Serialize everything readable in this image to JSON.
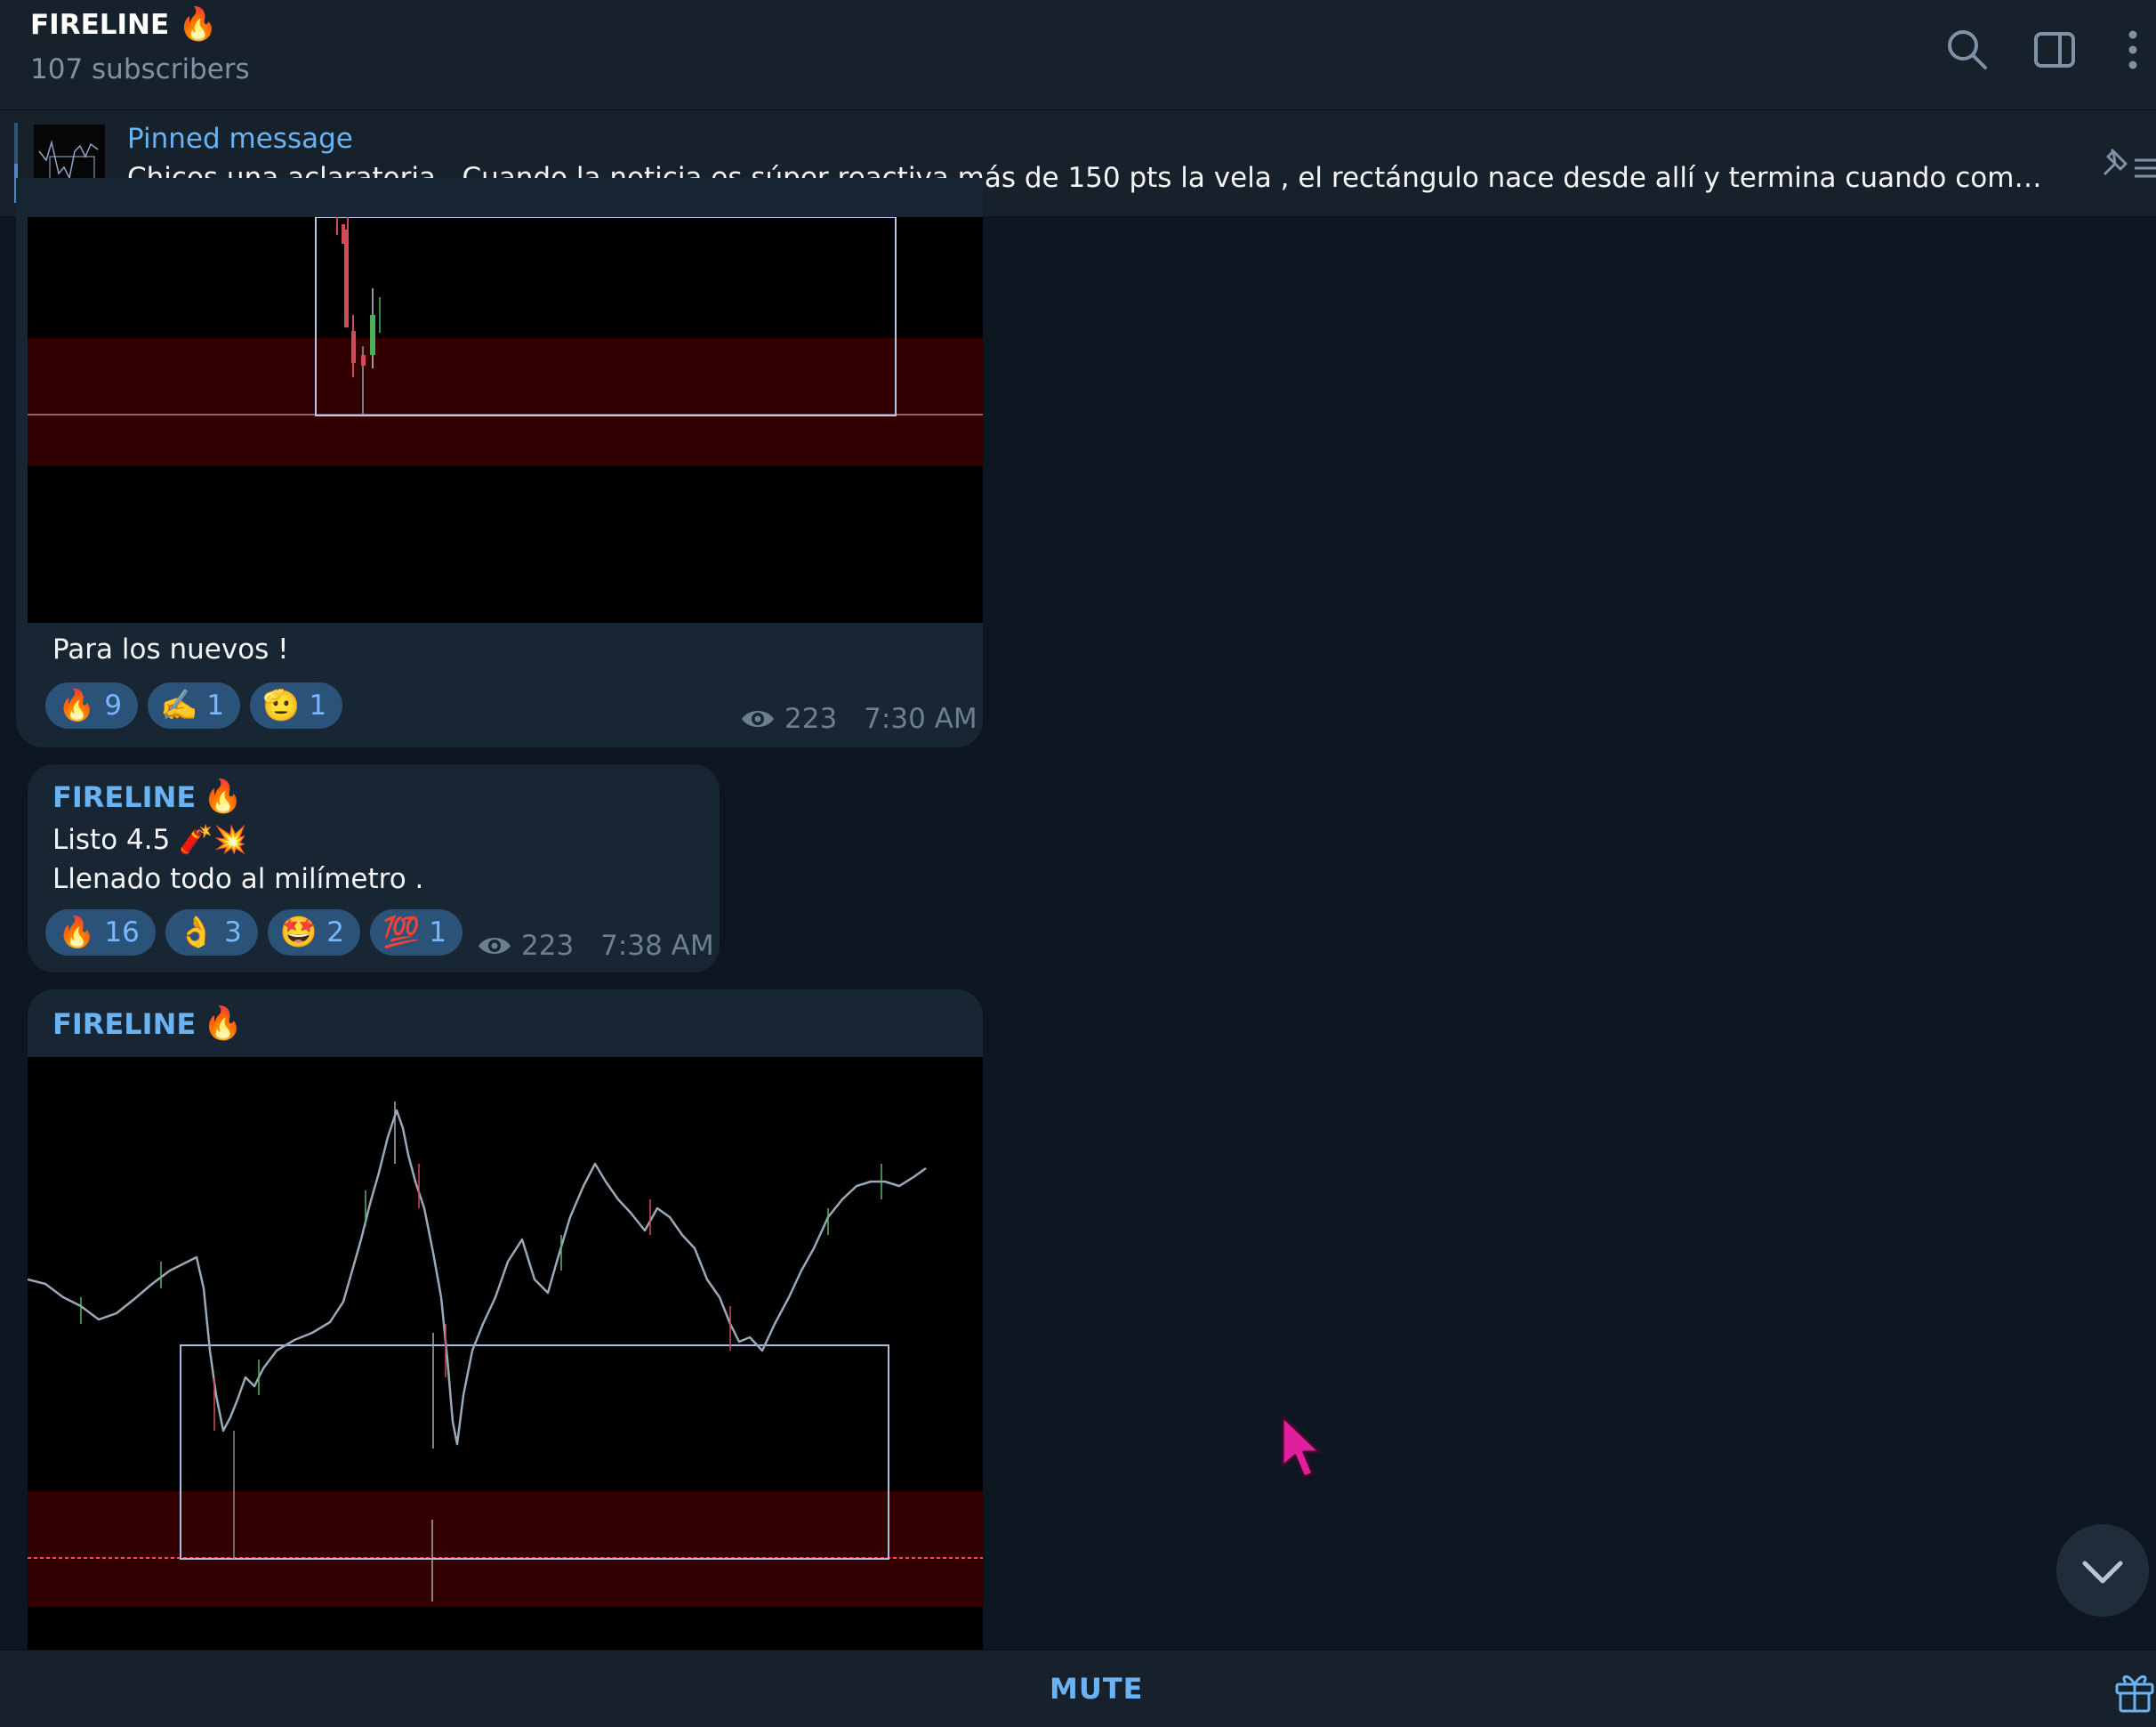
{
  "header": {
    "title": "FIRELINE",
    "title_emoji": "🔥",
    "subscribers": "107 subscribers",
    "icons": [
      "search-icon",
      "sidebar-toggle-icon",
      "more-vert-icon"
    ]
  },
  "pinned": {
    "label": "Pinned message",
    "text": "Chicos una aclaratoria .  Cuando la noticia es súper reactiva más de 150 pts la vela , el rectángulo nace desde allí y termina cuando complete las...",
    "icon": "pin-list-icon"
  },
  "messages": [
    {
      "caption": "Para los nuevos !",
      "reactions": [
        {
          "emoji": "🔥",
          "count": "9"
        },
        {
          "emoji": "✍️",
          "count": "1"
        },
        {
          "emoji": "🫡",
          "count": "1"
        }
      ],
      "views": "223",
      "time": "7:30 AM"
    },
    {
      "sender": "FIRELINE",
      "sender_emoji": "🔥",
      "line1": "Listo 4.5 🧨💥",
      "line2": "Llenado todo al milímetro .",
      "reactions": [
        {
          "emoji": "🔥",
          "count": "16"
        },
        {
          "emoji": "👌",
          "count": "3"
        },
        {
          "emoji": "🤩",
          "count": "2"
        },
        {
          "emoji": "💯",
          "count": "1"
        }
      ],
      "views": "223",
      "time": "7:38 AM"
    },
    {
      "sender": "FIRELINE",
      "sender_emoji": "🔥"
    }
  ],
  "footer": {
    "mute_label": "MUTE",
    "gift_icon": "gift-icon"
  },
  "colors": {
    "background": "#0e1621",
    "panel": "#17212b",
    "bubble": "#182533",
    "accent": "#6ab3f3",
    "zone_red": "#330000"
  }
}
